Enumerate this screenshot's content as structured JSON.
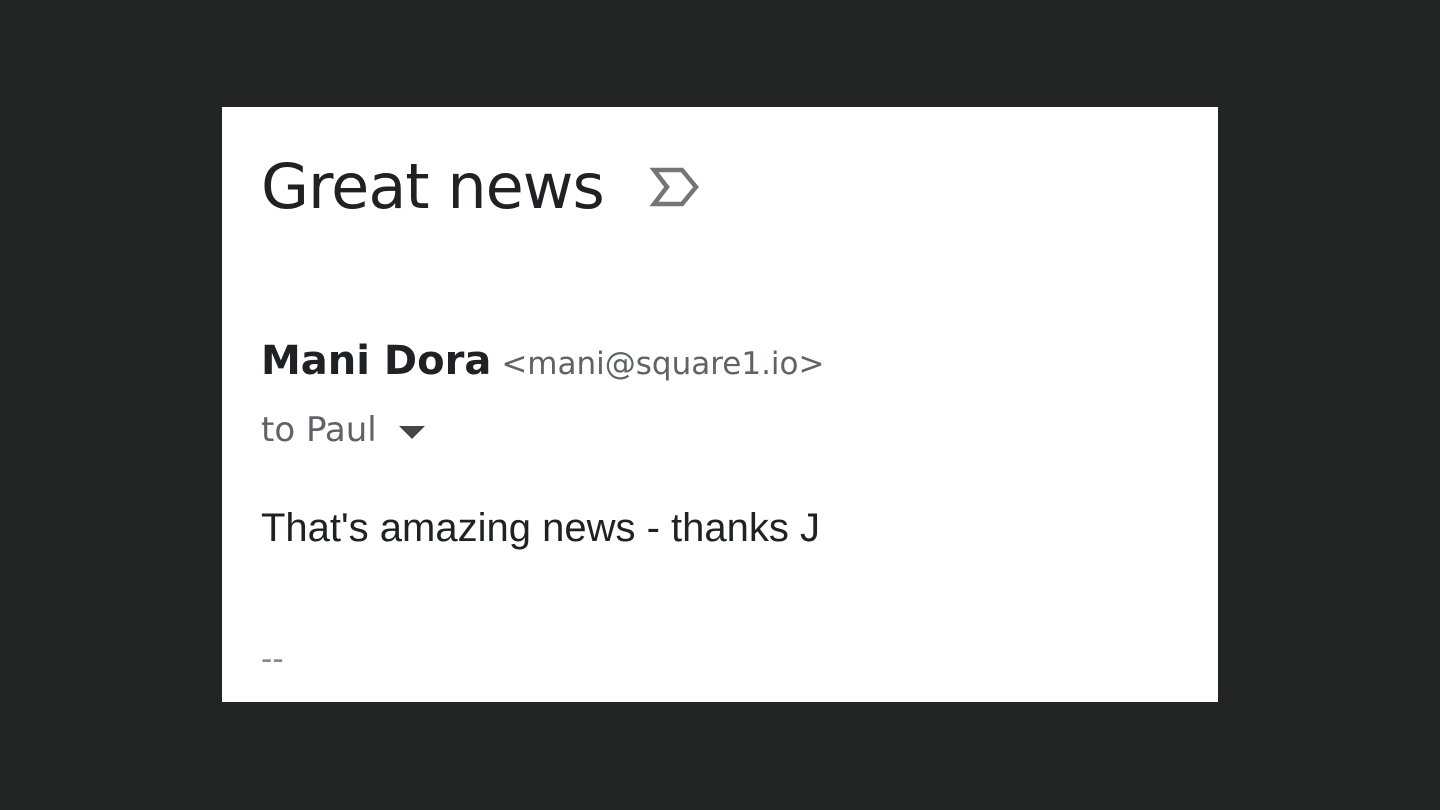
{
  "email": {
    "subject": "Great news",
    "important_icon": "important-marker-icon",
    "sender": {
      "name": "Mani Dora",
      "email": "<mani@square1.io>"
    },
    "recipient": {
      "label": "to Paul",
      "dropdown_icon": "caret-down-icon"
    },
    "body": "That's amazing news - thanks J",
    "signature_separator": "--"
  },
  "colors": {
    "background": "#232424",
    "card": "#ffffff",
    "text_primary": "#202124",
    "text_secondary": "#5f6368",
    "icon": "#757575"
  }
}
